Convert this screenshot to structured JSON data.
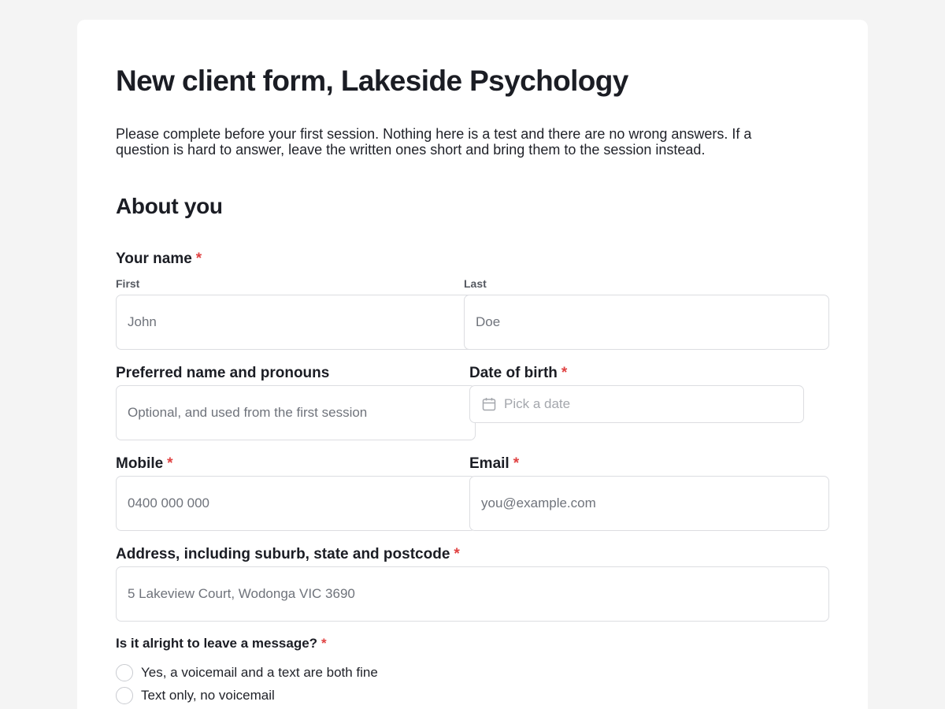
{
  "form": {
    "title": "New client form, Lakeside Psychology",
    "intro": "Please complete before your first session. Nothing here is a test and there are no wrong answers. If a question is hard to answer, leave the written ones short and bring them to the session instead.",
    "section_title": "About you",
    "required_mark": "*",
    "name": {
      "label": "Your name",
      "first_label": "First",
      "first_placeholder": "John",
      "last_label": "Last",
      "last_placeholder": "Doe"
    },
    "preferred": {
      "label": "Preferred name and pronouns",
      "placeholder": "Optional, and used from the first session"
    },
    "dob": {
      "label": "Date of birth",
      "placeholder": "Pick a date",
      "icon": "calendar-icon"
    },
    "mobile": {
      "label": "Mobile",
      "placeholder": "0400 000 000"
    },
    "email": {
      "label": "Email",
      "placeholder": "you@example.com"
    },
    "address": {
      "label": "Address, including suburb, state and postcode",
      "placeholder": "5 Lakeview Court, Wodonga VIC 3690"
    },
    "message": {
      "label": "Is it alright to leave a message?",
      "options": [
        "Yes, a voicemail and a text are both fine",
        "Text only, no voicemail"
      ]
    }
  },
  "colors": {
    "required": "#e04242",
    "border": "#dcdde1",
    "background": "#f4f4f4"
  }
}
